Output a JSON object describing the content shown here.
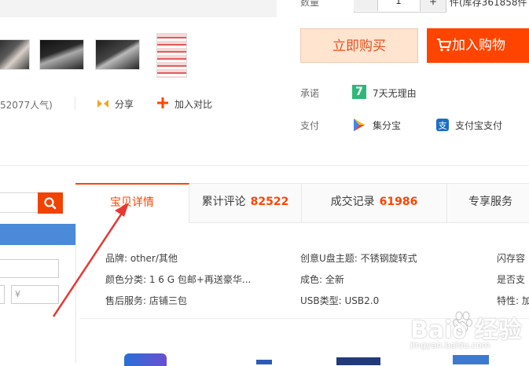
{
  "purchase": {
    "qty_label": "数量",
    "qty_value": "1",
    "qty_plus": "+",
    "stock_text": "件(库存361858件",
    "buy_now_label": "立即购买",
    "add_cart_label": "加入购物",
    "accent_color": "#ff4400"
  },
  "actions": {
    "popularity_text": "52077人气)",
    "share_label": "分享",
    "compare_label": "加入对比"
  },
  "services": {
    "promise_label": "承诺",
    "promise_icon_text": "7",
    "promise_text": "7天无理由",
    "pay_label": "支付",
    "jifen_text": "集分宝",
    "alipay_icon_text": "支",
    "alipay_text": "支付宝支付"
  },
  "sidebar": {
    "price_placeholder": "¥"
  },
  "tabs": [
    {
      "label": "宝贝详情",
      "count": ""
    },
    {
      "label": "累计评论",
      "count": "82522"
    },
    {
      "label": "成交记录",
      "count": "61986"
    },
    {
      "label": "专享服务",
      "count": ""
    }
  ],
  "attributes": {
    "col1": [
      "品牌: other/其他",
      "颜色分类: 1 6 G 包邮+再送豪华...",
      "售后服务: 店铺三包"
    ],
    "col2": [
      "创意U盘主题: 不锈钢旋转式",
      "成色: 全新",
      "USB类型: USB2.0"
    ],
    "col3": [
      "闪存容",
      "是否支",
      "特性: 加"
    ]
  },
  "watermark": {
    "text": "Baiꝺ 经验",
    "sub": "jingyan.baidu.com"
  }
}
